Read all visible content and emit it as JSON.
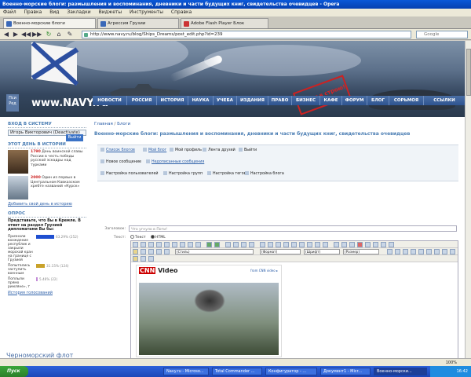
{
  "window": {
    "title": "Военно-морские блоги: размышления и воспоминания, дневники и части будущих книг, свидетельства очевидцев - Opera"
  },
  "menu": [
    "Файл",
    "Правка",
    "Вид",
    "Закладки",
    "Виджеты",
    "Инструменты",
    "Справка"
  ],
  "tabs": [
    "Военно-морские блоги",
    "Агрессия Грузии",
    "Adobe Flash Player Блок"
  ],
  "address": {
    "url": "http://www.navy.ru/blog/Ships_Dreams/post_edit.php?id=239"
  },
  "search": {
    "placeholder": "Google"
  },
  "banner": {
    "logo": "www.NAVY.ru",
    "stamp": "10 лет в строю!",
    "side_button": "Пси Ред"
  },
  "topnav": [
    "НОВОСТИ",
    "РОССИЯ",
    "ИСТОРИЯ",
    "НАУКА",
    "УЧЕБА",
    "ИЗДАНИЯ",
    "ПРАВО",
    "БИЗНЕС",
    "КАФЕ",
    "ФОРУМ",
    "БЛОГ",
    "СОРЬМОЯ",
    "ССЫЛКИ"
  ],
  "login": {
    "heading": "ВХОД В СИСТЕМУ",
    "field": "Игорь Викторович (Deactivate)",
    "button": "Выйти"
  },
  "day": {
    "heading": "ЭТОТ ДЕНЬ В ИСТОРИИ",
    "items": [
      {
        "year": "1790",
        "text": "День воинской славы России в честь победы русской эскадры над турками"
      },
      {
        "year": "2000",
        "text": "Один из первых в Центральном Кавказском хребте названий «Курск»"
      }
    ],
    "add_link": "Добавить свой день в историю"
  },
  "poll": {
    "heading": "ОПРОС",
    "question": "Представьте, что Вы в Кремле. В ответ на раздел Грузией дипломатами Вы бы:",
    "options": [
      {
        "label": "Признали вхождение республик и закрыли морской кран на границе с Грузией",
        "value": "63.29% (252)",
        "color": "#1f4fd0",
        "fraction": 0.6329
      },
      {
        "label": "Попытались заступить военным",
        "value": "31.15% (124)",
        "color": "#c9a22a",
        "fraction": 0.3115
      },
      {
        "label": "Поплыли прямо римляне», т",
        "value": "5.46% (22)",
        "color": "#c48cd8",
        "fraction": 0.0546
      }
    ],
    "history_link": "История голосований"
  },
  "footer_title": "Черноморский флот",
  "breadcrumb": {
    "home": "Главная",
    "sep": "/",
    "current": "Блоги"
  },
  "page_title": "Военно-морские блоги: размышления и воспоминания, дневники и части будущих книг, свидетельства очевидцев",
  "blog_tools": {
    "row1": [
      "Список блогов",
      "Мой блог",
      "Мой профиль",
      "Лента друзей",
      "Выйти"
    ],
    "row2": [
      "Новое сообщение",
      "Недописанные сообщения"
    ],
    "row3": [
      "Настройка пользователей",
      "Настройка групп",
      "Настройка тегов",
      "Настройка блога"
    ]
  },
  "form": {
    "title_label": "Заголовок:",
    "title_value": "Что угнуло в Поти!",
    "text_label": "Текст:",
    "mode_text": "Текст",
    "mode_html": "HTML",
    "style_select": "(Стиль)",
    "format_select": "(Формат)",
    "font_select": "(Шрифт)",
    "size_select": "(Размер)"
  },
  "embed": {
    "cnn1": "CNN",
    "cnn2": "Video",
    "right_link": "from CNN video ▸"
  },
  "status": {
    "text": "",
    "zoom": "100%"
  },
  "taskbar": {
    "start": "Пуск",
    "items": [
      "Navy.ru - Microso...",
      "Total Commander ...",
      "Конфигуратор - ...",
      "Документ1 - Micr...",
      "Военно-морски..."
    ],
    "time": "16:42"
  }
}
